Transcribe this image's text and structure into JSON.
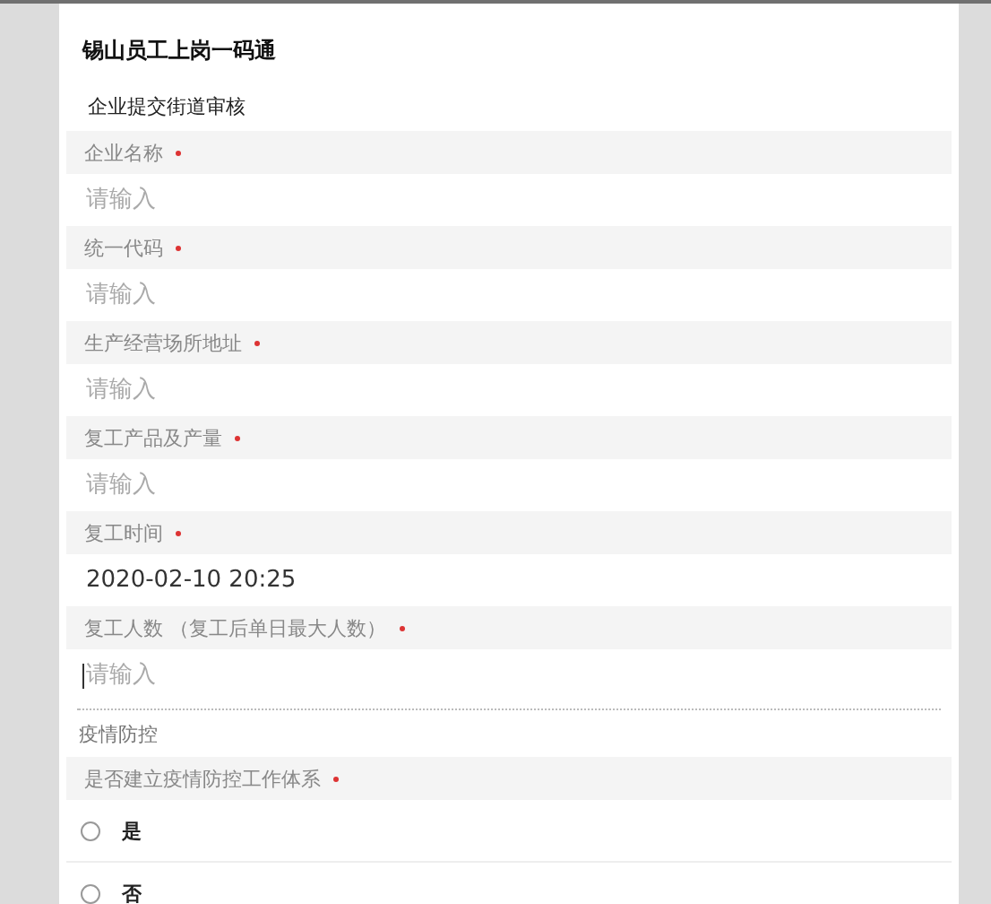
{
  "title": "锡山员工上岗一码通",
  "subtitle": "企业提交街道审核",
  "fields": [
    {
      "label": "企业名称",
      "required": true,
      "placeholder": "请输入",
      "focused": false
    },
    {
      "label": "统一代码",
      "required": true,
      "placeholder": "请输入",
      "focused": false
    },
    {
      "label": "生产经营场所地址",
      "required": true,
      "placeholder": "请输入",
      "focused": false
    },
    {
      "label": "复工产品及产量",
      "required": true,
      "placeholder": "请输入",
      "focused": false
    },
    {
      "label": "复工时间",
      "required": true,
      "value": "2020-02-10 20:25",
      "focused": false
    },
    {
      "label": "复工人数 （复工后单日最大人数）",
      "required": true,
      "placeholder": "请输入",
      "focused": true
    }
  ],
  "section": "疫情防控",
  "question": {
    "label": "是否建立疫情防控工作体系",
    "required": true,
    "options": [
      {
        "label": "是",
        "selected": false
      },
      {
        "label": "否",
        "selected": false
      }
    ]
  }
}
